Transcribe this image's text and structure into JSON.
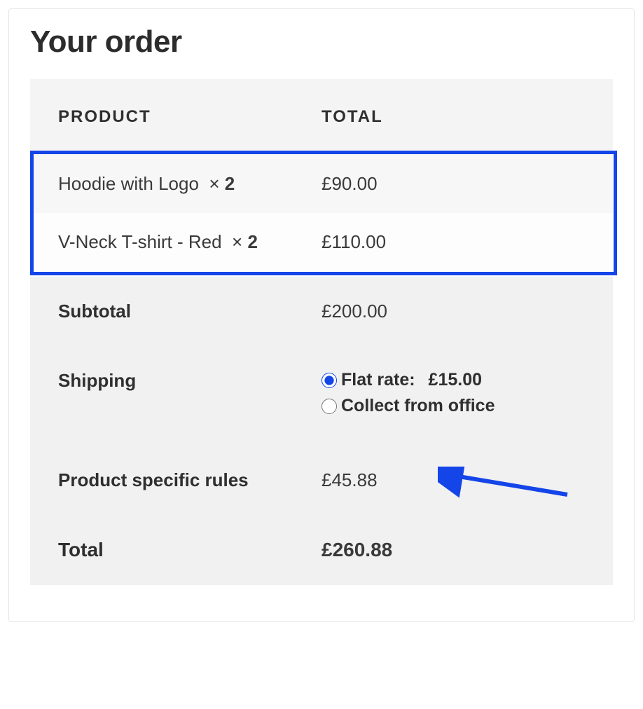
{
  "title": "Your order",
  "headers": {
    "product": "PRODUCT",
    "total": "TOTAL"
  },
  "items": [
    {
      "name": "Hoodie with Logo",
      "mult": "×",
      "qty": "2",
      "price": "£90.00"
    },
    {
      "name": "V-Neck T-shirt - Red",
      "mult": "×",
      "qty": "2",
      "price": "£110.00"
    }
  ],
  "subtotal_label": "Subtotal",
  "subtotal_value": "£200.00",
  "shipping_label": "Shipping",
  "shipping_options": [
    {
      "label": "Flat rate:",
      "price": "£15.00",
      "selected": true
    },
    {
      "label": "Collect from office",
      "price": "",
      "selected": false
    }
  ],
  "fee_label": "Product specific rules",
  "fee_value": "£45.88",
  "total_label": "Total",
  "total_value": "£260.88",
  "annotations": {
    "highlight_color": "#1445e8"
  }
}
